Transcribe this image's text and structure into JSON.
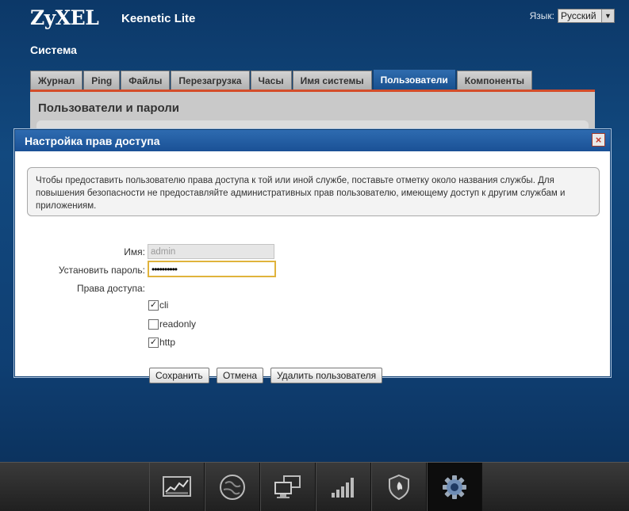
{
  "header": {
    "logo": "ZyXEL",
    "product": "Keenetic Lite",
    "language_label": "Язык:",
    "language_value": "Русский"
  },
  "section_title": "Система",
  "tabs": [
    {
      "label": "Журнал",
      "active": false
    },
    {
      "label": "Ping",
      "active": false
    },
    {
      "label": "Файлы",
      "active": false
    },
    {
      "label": "Перезагрузка",
      "active": false
    },
    {
      "label": "Часы",
      "active": false
    },
    {
      "label": "Имя системы",
      "active": false
    },
    {
      "label": "Пользователи",
      "active": true
    },
    {
      "label": "Компоненты",
      "active": false
    }
  ],
  "panel": {
    "title": "Пользователи и пароли"
  },
  "dialog": {
    "title": "Настройка прав доступа",
    "close_label": "×",
    "info_text": "Чтобы предоставить пользователю права доступа к той или иной службе, поставьте отметку около названия службы. Для повышения безопасности не предоставляйте административных прав пользователю, имеющему доступ к другим службам и приложениям.",
    "name_label": "Имя:",
    "name_value": "admin",
    "password_label": "Установить пароль:",
    "password_value": "••••••••••",
    "access_label": "Права доступа:",
    "permissions": [
      {
        "label": "cli",
        "checked": true
      },
      {
        "label": "readonly",
        "checked": false
      },
      {
        "label": "http",
        "checked": true
      }
    ],
    "save_label": "Сохранить",
    "cancel_label": "Отмена",
    "delete_label": "Удалить пользователя"
  },
  "dock": {
    "items": [
      {
        "icon": "monitor-chart-icon",
        "active": false
      },
      {
        "icon": "globe-icon",
        "active": false
      },
      {
        "icon": "network-computers-icon",
        "active": false
      },
      {
        "icon": "signal-bars-icon",
        "active": false
      },
      {
        "icon": "shield-icon",
        "active": false
      },
      {
        "icon": "gear-icon",
        "active": true
      }
    ]
  },
  "colors": {
    "accent": "#1a5196",
    "panel_border": "#d44d2a",
    "focus": "#e0b33c"
  }
}
